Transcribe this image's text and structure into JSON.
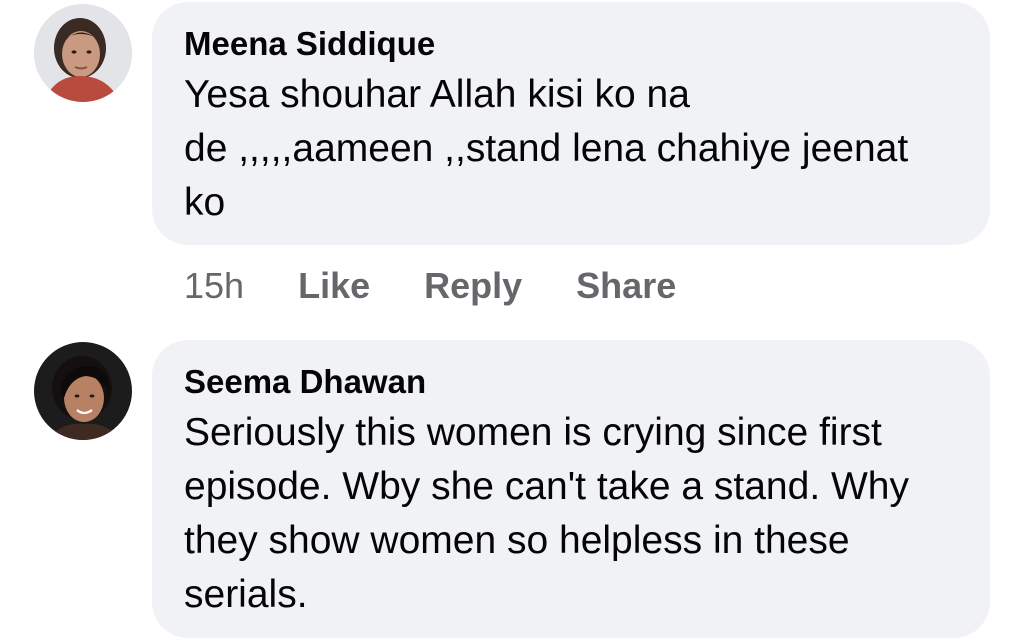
{
  "comments": [
    {
      "author": "Meena Siddique",
      "lines": [
        "Yesa shouhar Allah kisi ko na",
        "de ,,,,,aameen ,,stand lena chahiye jeenat",
        "ko"
      ],
      "time": "15h",
      "like_label": "Like",
      "reply_label": "Reply",
      "share_label": "Share",
      "avatar_icon": "profile-photo-icon"
    },
    {
      "author": "Seema Dhawan",
      "lines": [
        "Seriously this women is crying since first",
        "episode. Wby she can't take a stand. Why",
        "they show women so helpless in these",
        "serials."
      ],
      "avatar_icon": "profile-photo-icon"
    }
  ],
  "colors": {
    "bubble": "#f0f2f5",
    "text": "#050505",
    "meta": "#65676b"
  }
}
